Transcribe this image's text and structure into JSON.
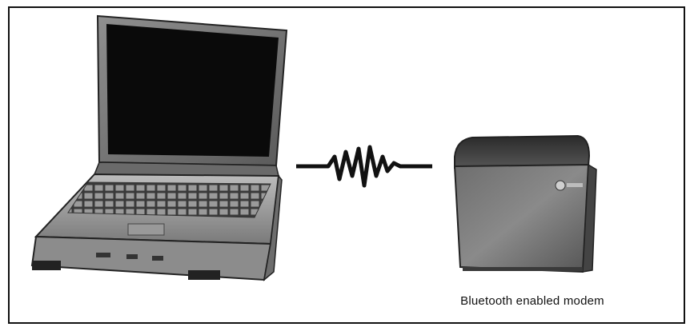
{
  "diagram": {
    "caption": "Bluetooth enabled modem"
  },
  "icons": {
    "laptop": "laptop-icon",
    "wireless_link": "wireless-signal-icon",
    "modem": "modem-icon"
  }
}
